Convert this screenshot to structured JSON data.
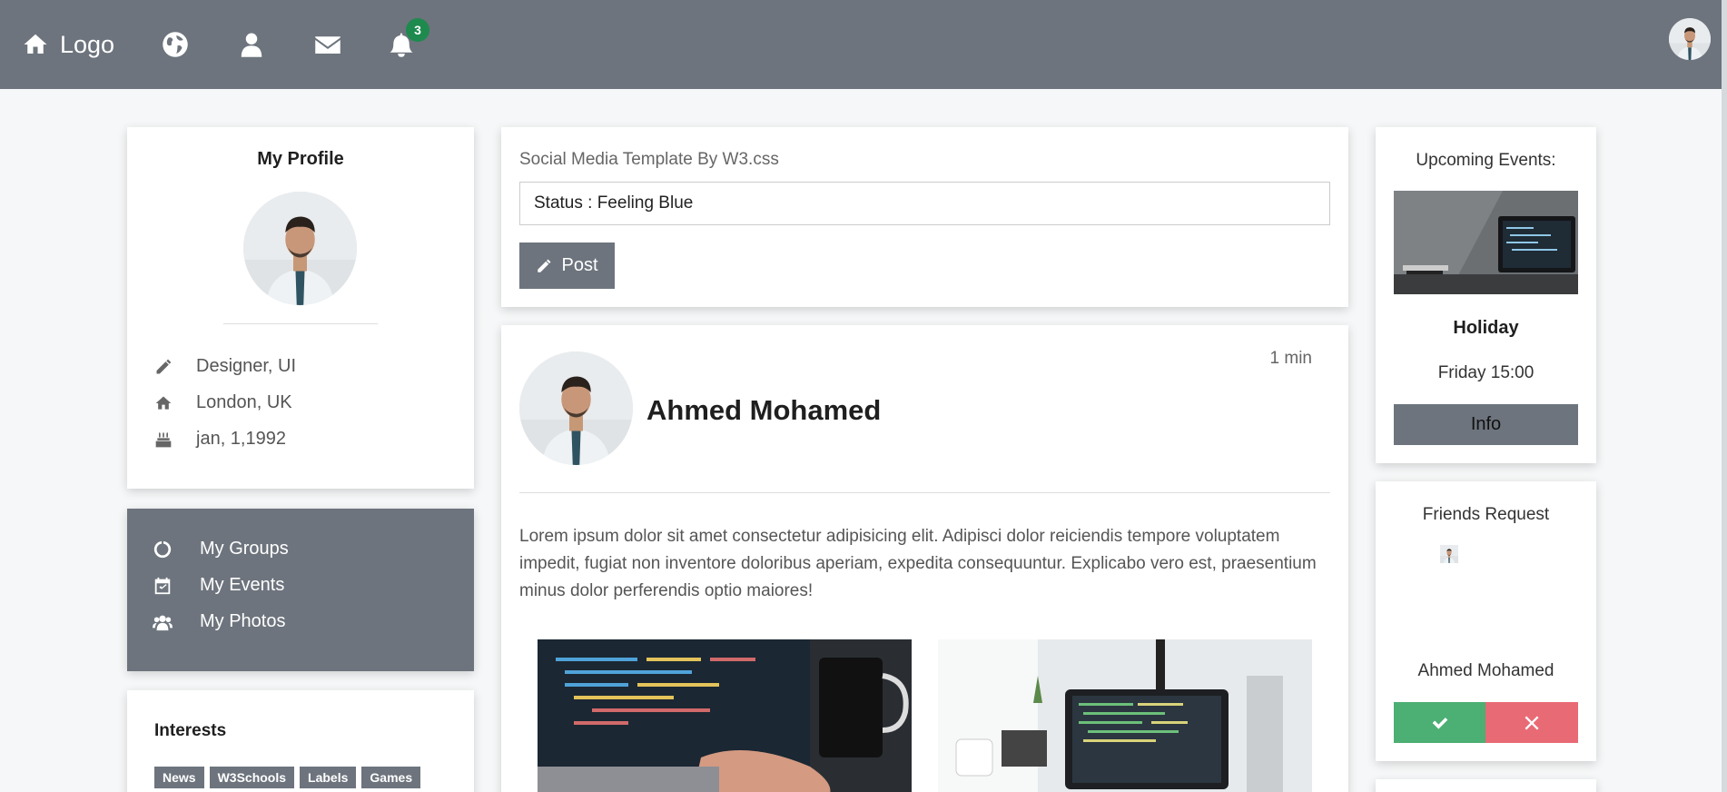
{
  "nav": {
    "logo": "Logo",
    "notification_count": "3"
  },
  "profile": {
    "title": "My Profile",
    "job": "Designer, UI",
    "location": "London, UK",
    "birthday": "jan, 1,1992"
  },
  "menu": {
    "groups": "My Groups",
    "events": "My Events",
    "photos": "My Photos"
  },
  "interests": {
    "title": "Interests",
    "tags": [
      "News",
      "W3Schools",
      "Labels",
      "Games"
    ]
  },
  "status": {
    "subtitle": "Social Media Template By W3.css",
    "value": "Status : Feeling Blue",
    "post_label": "Post"
  },
  "post": {
    "author": "Ahmed Mohamed",
    "time": "1 min",
    "text": "Lorem ipsum dolor sit amet consectetur adipisicing elit. Adipisci dolor reiciendis tempore voluptatem impedit, fugiat non inventore doloribus aperiam, expedita consequuntur. Explicabo vero est, praesentium minus dolor perferendis optio maiores!"
  },
  "events": {
    "title": "Upcoming Events:",
    "name": "Holiday",
    "when": "Friday 15:00",
    "info_label": "Info"
  },
  "friends": {
    "title": "Friends Request",
    "name": "Ahmed Mohamed"
  }
}
